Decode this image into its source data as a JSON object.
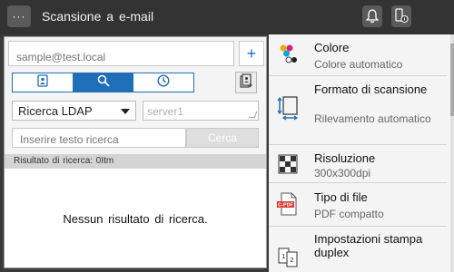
{
  "header": {
    "menu_label": "···",
    "title": "Scansione a e-mail",
    "icons": [
      "bell-icon",
      "phone-icon"
    ]
  },
  "destination": {
    "email_placeholder": "sample@test.local",
    "add_label": "+"
  },
  "tabs": [
    {
      "icon": "address-book-icon",
      "active": false
    },
    {
      "icon": "search-icon",
      "active": true
    },
    {
      "icon": "history-clock-icon",
      "active": false
    }
  ],
  "ldap": {
    "selected": "Ricerca LDAP",
    "server_placeholder": "server1",
    "search_placeholder": "Inserire testo ricerca",
    "search_button": "Cerca"
  },
  "results": {
    "summary": "Risultato di ricerca: 0Itm",
    "empty_message": "Nessun risultato di ricerca."
  },
  "settings": [
    {
      "name": "Colore",
      "value": "Colore automatico",
      "icon": "color-icon"
    },
    {
      "name": "Formato di scansione",
      "value": "Rilevamento automatico",
      "icon": "scan-size-icon"
    },
    {
      "name": "Risoluzione",
      "value": "300x300dpi",
      "icon": "resolution-icon"
    },
    {
      "name": "Tipo di file",
      "value": "PDF compatto",
      "icon": "file-type-icon",
      "icon_text": "C-PDF"
    },
    {
      "name": "Impostazioni stampa duplex",
      "value": "",
      "icon": "duplex-icon"
    }
  ],
  "colors": {
    "header_bg": "#333333",
    "accent": "#1e6fb8",
    "panel_bg": "#f4f4f4"
  }
}
